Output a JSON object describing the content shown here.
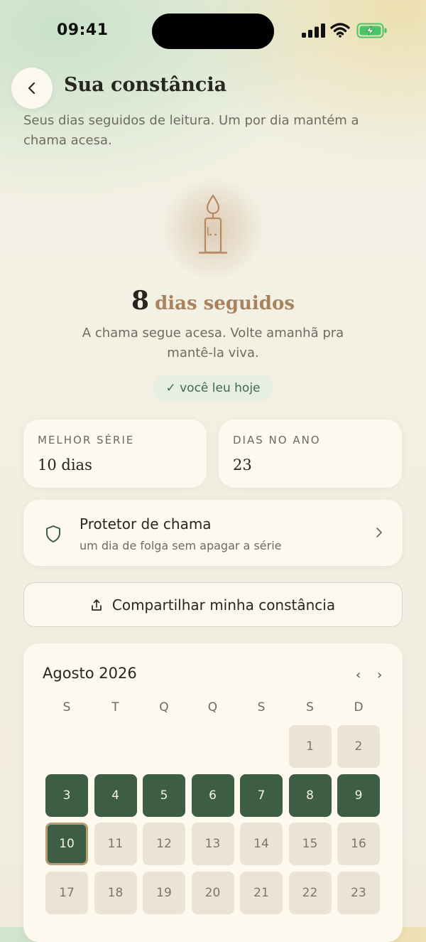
{
  "status_bar": {
    "time": "09:41"
  },
  "header": {
    "title": "Sua constância",
    "subtitle": "Seus dias seguidos de leitura. Um por dia mantém a chama acesa."
  },
  "streak": {
    "count": "8",
    "label": "dias seguidos",
    "message": "A chama segue acesa. Volte amanhã pra mantê-la viva.",
    "read_today_badge": "✓ você leu hoje"
  },
  "stats": {
    "best": {
      "label": "MELHOR SÉRIE",
      "value": "10 dias"
    },
    "year": {
      "label": "DIAS NO ANO",
      "value": "23"
    }
  },
  "protector": {
    "title": "Protetor de chama",
    "subtitle": "um dia de folga sem apagar a série"
  },
  "share": {
    "label": "Compartilhar minha constância"
  },
  "calendar": {
    "month_label": "Agosto 2026",
    "prev": "‹",
    "next": "›",
    "weekdays": [
      "S",
      "T",
      "Q",
      "Q",
      "S",
      "S",
      "D"
    ],
    "days": [
      "1",
      "2",
      "3",
      "4",
      "5",
      "6",
      "7",
      "8",
      "9",
      "10",
      "11",
      "12",
      "13",
      "14",
      "15",
      "16",
      "17",
      "18",
      "19",
      "20",
      "21",
      "22",
      "23"
    ],
    "read_days": [
      "3",
      "4",
      "5",
      "6",
      "7",
      "8",
      "9",
      "10"
    ],
    "today": "10"
  },
  "colors": {
    "accent_green": "#3d5e45",
    "warm_accent": "#a9825e",
    "badge_bg": "#e6efe2",
    "battery_green": "#4cc46a"
  },
  "icons": {
    "back": "chevron-left-icon",
    "candle": "candle-icon",
    "shield": "shield-icon",
    "share": "share-upload-icon",
    "chevron": "chevron-right-icon"
  }
}
